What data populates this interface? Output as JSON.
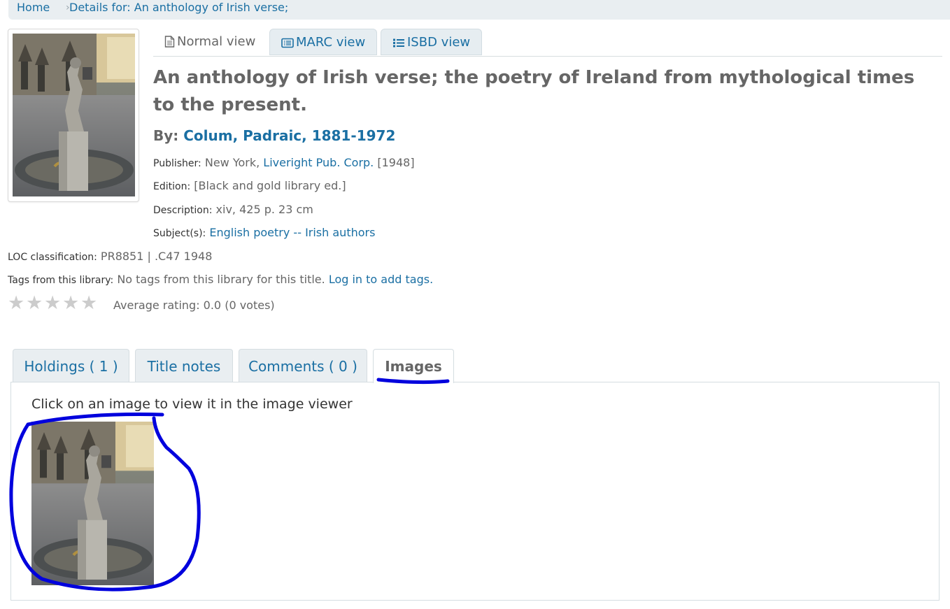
{
  "breadcrumb": {
    "home": "Home",
    "separator": "›",
    "current": "Details for: An anthology of Irish verse;"
  },
  "views": {
    "normal": "Normal view",
    "marc": "MARC view",
    "isbd": "ISBD view"
  },
  "record": {
    "title": "An anthology of Irish verse; the poetry of Ireland from mythological times to the present.",
    "by_label": "By:",
    "author": "Colum, Padraic, 1881-1972",
    "publisher_label": "Publisher:",
    "publisher_place": "New York,",
    "publisher_name": "Liveright Pub. Corp.",
    "publisher_date": "[1948]",
    "edition_label": "Edition:",
    "edition": "[Black and gold library ed.]",
    "description_label": "Description:",
    "description": "xiv, 425 p. 23 cm",
    "subjects_label": "Subject(s):",
    "subjects": "English poetry -- Irish authors",
    "loc_label": "LOC classification:",
    "loc_value": "PR8851 | .C47 1948",
    "tags_label": "Tags from this library:",
    "tags_value": "No tags from this library for this title.",
    "tags_login": "Log in to add tags.",
    "rating": {
      "value": 0,
      "max": 5
    },
    "average_rating": "Average rating: 0.0 (0 votes)"
  },
  "tabs": {
    "holdings": "Holdings ( 1 )",
    "title_notes": "Title notes",
    "comments": "Comments ( 0 )",
    "images": "Images",
    "active": "images"
  },
  "images_panel": {
    "hint": "Click on an image to view it in the image viewer"
  },
  "colors": {
    "link": "#1a6fa3",
    "annotation": "#0000dd",
    "tab_background": "#e9eef1"
  },
  "icons": {
    "normal_view": "document-icon",
    "marc_view": "list-alt-icon",
    "isbd_view": "list-icon",
    "rating": "star-icon"
  }
}
